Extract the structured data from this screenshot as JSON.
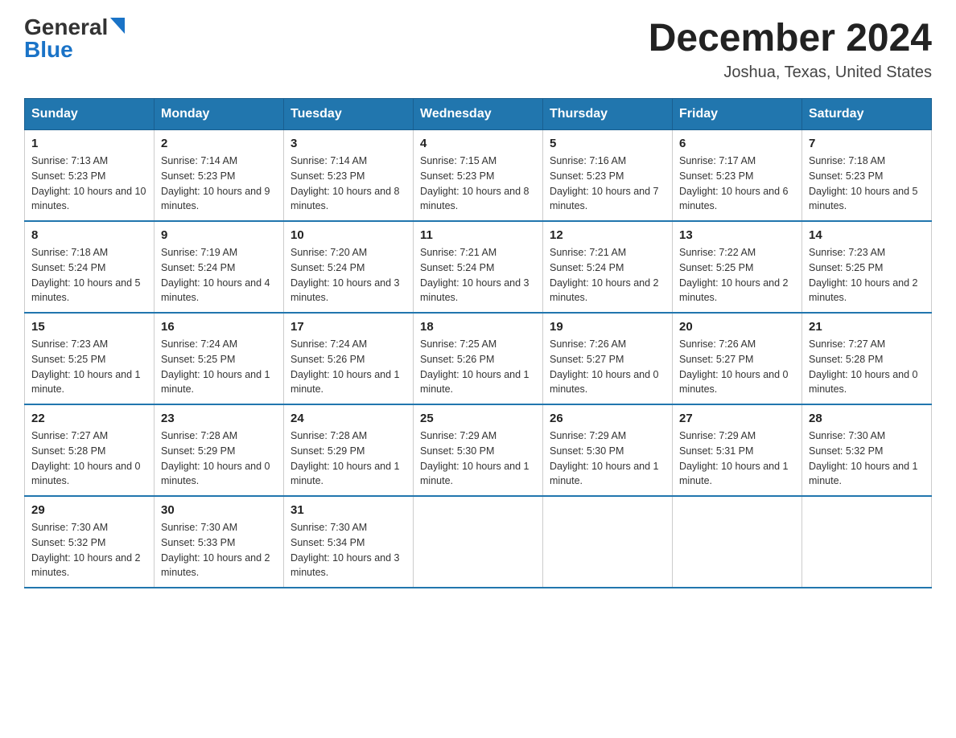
{
  "logo": {
    "general": "General",
    "blue": "Blue"
  },
  "title": {
    "month_year": "December 2024",
    "location": "Joshua, Texas, United States"
  },
  "weekdays": [
    "Sunday",
    "Monday",
    "Tuesday",
    "Wednesday",
    "Thursday",
    "Friday",
    "Saturday"
  ],
  "weeks": [
    [
      {
        "day": "1",
        "sunrise": "7:13 AM",
        "sunset": "5:23 PM",
        "daylight": "10 hours and 10 minutes."
      },
      {
        "day": "2",
        "sunrise": "7:14 AM",
        "sunset": "5:23 PM",
        "daylight": "10 hours and 9 minutes."
      },
      {
        "day": "3",
        "sunrise": "7:14 AM",
        "sunset": "5:23 PM",
        "daylight": "10 hours and 8 minutes."
      },
      {
        "day": "4",
        "sunrise": "7:15 AM",
        "sunset": "5:23 PM",
        "daylight": "10 hours and 8 minutes."
      },
      {
        "day": "5",
        "sunrise": "7:16 AM",
        "sunset": "5:23 PM",
        "daylight": "10 hours and 7 minutes."
      },
      {
        "day": "6",
        "sunrise": "7:17 AM",
        "sunset": "5:23 PM",
        "daylight": "10 hours and 6 minutes."
      },
      {
        "day": "7",
        "sunrise": "7:18 AM",
        "sunset": "5:23 PM",
        "daylight": "10 hours and 5 minutes."
      }
    ],
    [
      {
        "day": "8",
        "sunrise": "7:18 AM",
        "sunset": "5:24 PM",
        "daylight": "10 hours and 5 minutes."
      },
      {
        "day": "9",
        "sunrise": "7:19 AM",
        "sunset": "5:24 PM",
        "daylight": "10 hours and 4 minutes."
      },
      {
        "day": "10",
        "sunrise": "7:20 AM",
        "sunset": "5:24 PM",
        "daylight": "10 hours and 3 minutes."
      },
      {
        "day": "11",
        "sunrise": "7:21 AM",
        "sunset": "5:24 PM",
        "daylight": "10 hours and 3 minutes."
      },
      {
        "day": "12",
        "sunrise": "7:21 AM",
        "sunset": "5:24 PM",
        "daylight": "10 hours and 2 minutes."
      },
      {
        "day": "13",
        "sunrise": "7:22 AM",
        "sunset": "5:25 PM",
        "daylight": "10 hours and 2 minutes."
      },
      {
        "day": "14",
        "sunrise": "7:23 AM",
        "sunset": "5:25 PM",
        "daylight": "10 hours and 2 minutes."
      }
    ],
    [
      {
        "day": "15",
        "sunrise": "7:23 AM",
        "sunset": "5:25 PM",
        "daylight": "10 hours and 1 minute."
      },
      {
        "day": "16",
        "sunrise": "7:24 AM",
        "sunset": "5:25 PM",
        "daylight": "10 hours and 1 minute."
      },
      {
        "day": "17",
        "sunrise": "7:24 AM",
        "sunset": "5:26 PM",
        "daylight": "10 hours and 1 minute."
      },
      {
        "day": "18",
        "sunrise": "7:25 AM",
        "sunset": "5:26 PM",
        "daylight": "10 hours and 1 minute."
      },
      {
        "day": "19",
        "sunrise": "7:26 AM",
        "sunset": "5:27 PM",
        "daylight": "10 hours and 0 minutes."
      },
      {
        "day": "20",
        "sunrise": "7:26 AM",
        "sunset": "5:27 PM",
        "daylight": "10 hours and 0 minutes."
      },
      {
        "day": "21",
        "sunrise": "7:27 AM",
        "sunset": "5:28 PM",
        "daylight": "10 hours and 0 minutes."
      }
    ],
    [
      {
        "day": "22",
        "sunrise": "7:27 AM",
        "sunset": "5:28 PM",
        "daylight": "10 hours and 0 minutes."
      },
      {
        "day": "23",
        "sunrise": "7:28 AM",
        "sunset": "5:29 PM",
        "daylight": "10 hours and 0 minutes."
      },
      {
        "day": "24",
        "sunrise": "7:28 AM",
        "sunset": "5:29 PM",
        "daylight": "10 hours and 1 minute."
      },
      {
        "day": "25",
        "sunrise": "7:29 AM",
        "sunset": "5:30 PM",
        "daylight": "10 hours and 1 minute."
      },
      {
        "day": "26",
        "sunrise": "7:29 AM",
        "sunset": "5:30 PM",
        "daylight": "10 hours and 1 minute."
      },
      {
        "day": "27",
        "sunrise": "7:29 AM",
        "sunset": "5:31 PM",
        "daylight": "10 hours and 1 minute."
      },
      {
        "day": "28",
        "sunrise": "7:30 AM",
        "sunset": "5:32 PM",
        "daylight": "10 hours and 1 minute."
      }
    ],
    [
      {
        "day": "29",
        "sunrise": "7:30 AM",
        "sunset": "5:32 PM",
        "daylight": "10 hours and 2 minutes."
      },
      {
        "day": "30",
        "sunrise": "7:30 AM",
        "sunset": "5:33 PM",
        "daylight": "10 hours and 2 minutes."
      },
      {
        "day": "31",
        "sunrise": "7:30 AM",
        "sunset": "5:34 PM",
        "daylight": "10 hours and 3 minutes."
      },
      null,
      null,
      null,
      null
    ]
  ],
  "labels": {
    "sunrise_prefix": "Sunrise: ",
    "sunset_prefix": "Sunset: ",
    "daylight_prefix": "Daylight: "
  }
}
